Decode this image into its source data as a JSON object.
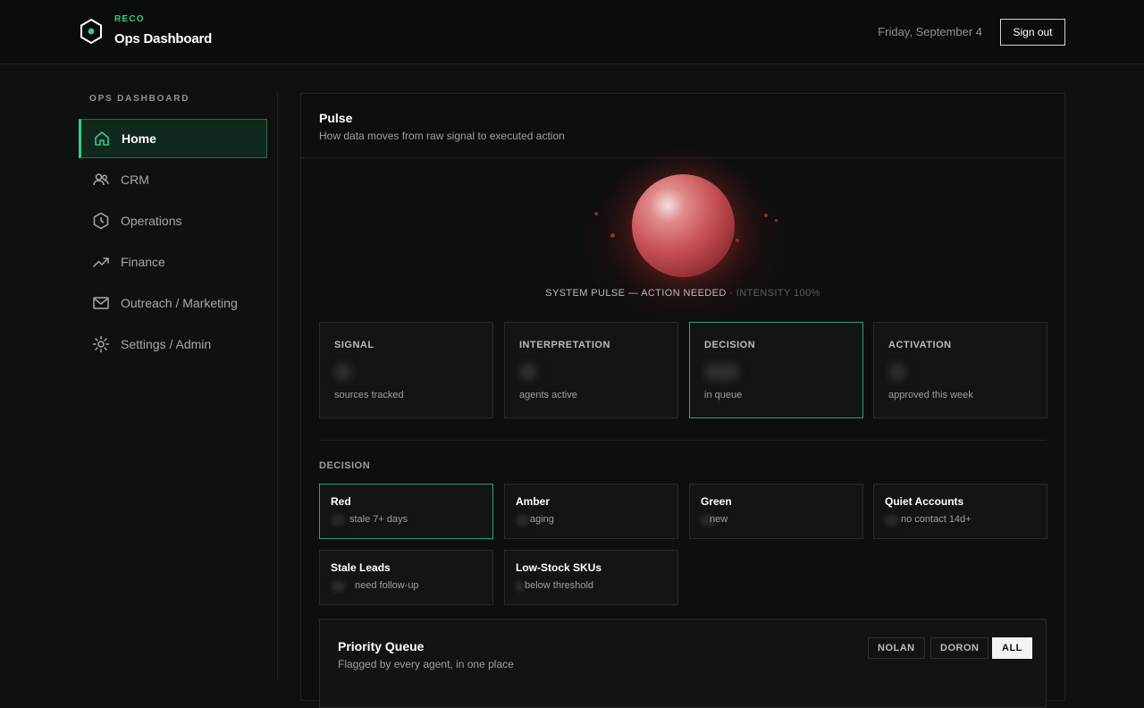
{
  "header": {
    "brand_tag": "RECO",
    "brand_title": "Ops Dashboard",
    "date": "Friday, September 4",
    "signout_label": "Sign out"
  },
  "sidebar": {
    "section_label": "OPS DASHBOARD",
    "items": [
      {
        "label": "Home",
        "icon": "home-icon",
        "active": true
      },
      {
        "label": "CRM",
        "icon": "users-icon"
      },
      {
        "label": "Operations",
        "icon": "clock-icon"
      },
      {
        "label": "Finance",
        "icon": "trend-up-icon"
      },
      {
        "label": "Outreach / Marketing",
        "icon": "mail-icon"
      },
      {
        "label": "Settings / Admin",
        "icon": "sun-gear-icon"
      }
    ]
  },
  "pulse": {
    "title": "Pulse",
    "subtitle": "How data moves from raw signal to executed action",
    "status": "SYSTEM PULSE — ACTION NEEDED",
    "intensity": "· INTENSITY 100%"
  },
  "stages": [
    {
      "label": "SIGNAL",
      "sub": "sources tracked"
    },
    {
      "label": "INTERPRETATION",
      "sub": "agents active"
    },
    {
      "label": "DECISION",
      "sub": "in queue",
      "highlight": true
    },
    {
      "label": "ACTIVATION",
      "sub": "approved this week"
    }
  ],
  "decision": {
    "section_label": "DECISION",
    "cards": [
      {
        "title": "Red",
        "sub": "stale 7+ days",
        "highlight": true
      },
      {
        "title": "Amber",
        "sub": "aging"
      },
      {
        "title": "Green",
        "sub": "new"
      },
      {
        "title": "Quiet Accounts",
        "sub": "no contact 14d+"
      },
      {
        "title": "Stale Leads",
        "sub": "need follow-up"
      },
      {
        "title": "Low-Stock SKUs",
        "sub": "below threshold"
      }
    ]
  },
  "queue": {
    "title": "Priority Queue",
    "subtitle": "Flagged by every agent, in one place",
    "filters": [
      {
        "label": "NOLAN"
      },
      {
        "label": "DORON"
      },
      {
        "label": "ALL",
        "selected": true
      }
    ]
  },
  "colors": {
    "accent": "#2fd08a",
    "pulse_red": "#c95457"
  }
}
